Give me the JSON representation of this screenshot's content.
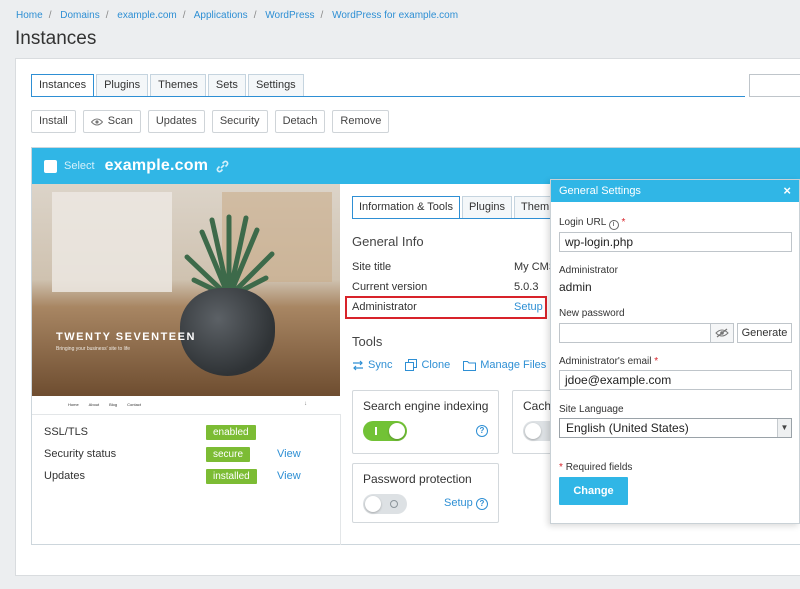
{
  "breadcrumb": [
    "Home",
    "Domains",
    "example.com",
    "Applications",
    "WordPress",
    "WordPress for example.com"
  ],
  "page_title": "Instances",
  "top_tabs": [
    "Instances",
    "Plugins",
    "Themes",
    "Sets",
    "Settings"
  ],
  "toolbar": [
    "Install",
    "Scan",
    "Updates",
    "Security",
    "Detach",
    "Remove"
  ],
  "instance": {
    "select_label": "Select",
    "domain": "example.com",
    "thumbnail": {
      "theme_name": "TWENTY SEVENTEEN",
      "tagline": "Bringing your business' site to life",
      "nav": [
        "Home",
        "About",
        "Blog",
        "Contact"
      ]
    },
    "status": [
      {
        "label": "SSL/TLS",
        "badge": "enabled",
        "view": ""
      },
      {
        "label": "Security status",
        "badge": "secure",
        "view": "View"
      },
      {
        "label": "Updates",
        "badge": "installed",
        "view": "View"
      }
    ],
    "info_tabs": [
      "Information & Tools",
      "Plugins",
      "Them"
    ],
    "general_info": {
      "title": "General Info",
      "rows": [
        {
          "label": "Site title",
          "value": "My CMS"
        },
        {
          "label": "Current version",
          "value": "5.0.3"
        },
        {
          "label": "Administrator",
          "value": "Setup"
        }
      ]
    },
    "tools": {
      "title": "Tools",
      "links": [
        "Sync",
        "Clone",
        "Manage Files"
      ],
      "cards": [
        {
          "title": "Search engine indexing",
          "state": "on"
        },
        {
          "title": "Cachi",
          "state": "off"
        },
        {
          "title": "Password protection",
          "state": "off",
          "link": "Setup"
        }
      ]
    }
  },
  "general_settings": {
    "title": "General Settings",
    "login_url_label": "Login URL",
    "login_url_value": "wp-login.php",
    "administrator_label": "Administrator",
    "administrator_value": "admin",
    "new_password_label": "New password",
    "new_password_value": "",
    "generate_label": "Generate",
    "email_label": "Administrator's email",
    "email_value": "jdoe@example.com",
    "language_label": "Site Language",
    "language_value": "English (United States)",
    "required_note": "Required fields",
    "change_label": "Change"
  },
  "colors": {
    "accent": "#30b6e6",
    "link": "#2e8fd4",
    "badge_green": "#7cbc34",
    "toggle_on": "#72c236",
    "highlight_red": "#d8232a"
  }
}
